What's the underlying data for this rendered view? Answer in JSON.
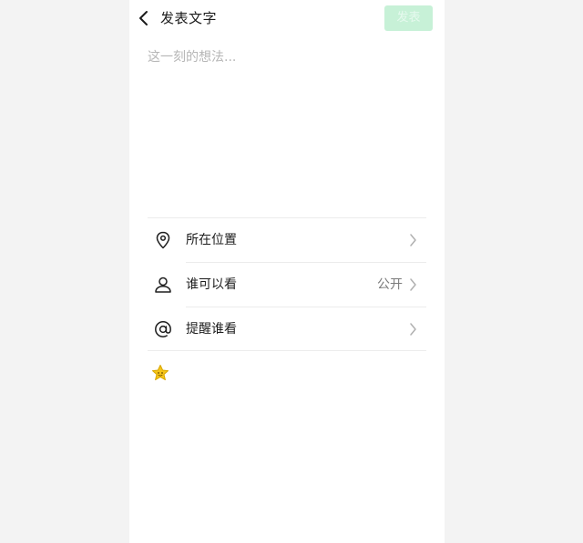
{
  "header": {
    "title": "发表文字",
    "publish_label": "发表"
  },
  "composer": {
    "placeholder": "这一刻的想法...",
    "value": ""
  },
  "options": [
    {
      "label": "所在位置",
      "value": "",
      "icon": "location-pin-icon"
    },
    {
      "label": "谁可以看",
      "value": "公开",
      "icon": "person-icon"
    },
    {
      "label": "提醒谁看",
      "value": "",
      "icon": "at-sign-icon"
    }
  ],
  "emoji_icon": "star-emoji-icon",
  "colors": {
    "accent_disabled": "#c7f1d7",
    "background": "#f3f3f3",
    "emoji_yellow": "#f5c518"
  }
}
